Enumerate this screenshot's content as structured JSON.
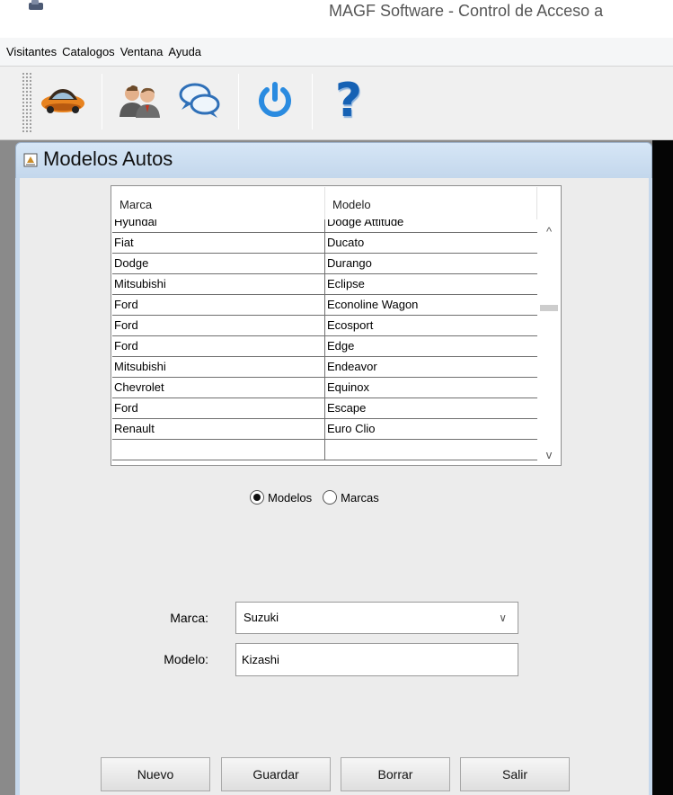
{
  "window": {
    "title": "MAGF Software - Control de Acceso a"
  },
  "menubar": {
    "items": [
      "Visitantes",
      "Catalogos",
      "Ventana",
      "Ayuda"
    ]
  },
  "toolbar": {
    "buttons": [
      {
        "icon": "car-icon"
      },
      {
        "icon": "users-icon"
      },
      {
        "icon": "chat-icon"
      },
      {
        "icon": "power-icon"
      },
      {
        "icon": "help-icon",
        "glyph": "?"
      }
    ],
    "colors": {
      "power": "#2a8be0",
      "help": "#1561b4",
      "car": "#e8831f"
    }
  },
  "internal_frame": {
    "title": "Modelos Autos"
  },
  "table": {
    "columns": [
      "Marca",
      "Modelo"
    ],
    "rows": [
      [
        "Hyundai",
        "Dodge Attitude"
      ],
      [
        "Fiat",
        "Ducato"
      ],
      [
        "Dodge",
        "Durango"
      ],
      [
        "Mitsubishi",
        "Eclipse"
      ],
      [
        "Ford",
        "Econoline Wagon"
      ],
      [
        "Ford",
        "Ecosport"
      ],
      [
        "Ford",
        "Edge"
      ],
      [
        "Mitsubishi",
        "Endeavor"
      ],
      [
        "Chevrolet",
        "Equinox"
      ],
      [
        "Ford",
        "Escape"
      ],
      [
        "Renault",
        "Euro Clio"
      ],
      [
        "",
        ""
      ]
    ],
    "scroll": {
      "up_arrow": "^",
      "down_arrow": "v"
    }
  },
  "view_toggle": {
    "options": [
      {
        "label": "Modelos",
        "selected": true
      },
      {
        "label": "Marcas",
        "selected": false
      }
    ]
  },
  "form": {
    "marca_label": "Marca:",
    "marca_value": "Suzuki",
    "modelo_label": "Modelo:",
    "modelo_value": "Kizashi"
  },
  "buttons": {
    "nuevo": "Nuevo",
    "guardar": "Guardar",
    "borrar": "Borrar",
    "salir": "Salir"
  }
}
